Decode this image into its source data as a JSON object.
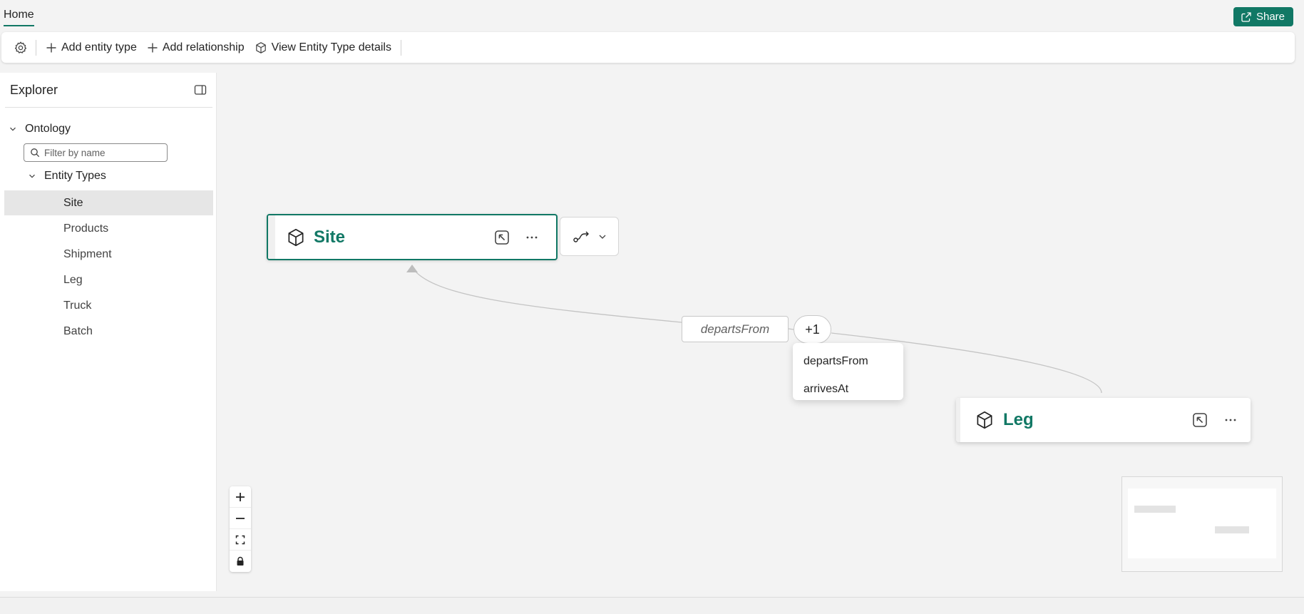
{
  "topbar": {
    "home_tab": "Home",
    "share_label": "Share"
  },
  "toolbar": {
    "settings_icon": "gear-icon",
    "add_entity_type": "Add entity type",
    "add_relationship": "Add relationship",
    "view_entity_type_details": "View Entity Type details"
  },
  "explorer": {
    "title": "Explorer",
    "root_label": "Ontology",
    "filter_placeholder": "Filter by name",
    "group_label": "Entity Types",
    "items": [
      {
        "label": "Site",
        "selected": true
      },
      {
        "label": "Products",
        "selected": false
      },
      {
        "label": "Shipment",
        "selected": false
      },
      {
        "label": "Leg",
        "selected": false
      },
      {
        "label": "Truck",
        "selected": false
      },
      {
        "label": "Batch",
        "selected": false
      }
    ]
  },
  "canvas": {
    "nodes": {
      "site": {
        "title": "Site"
      },
      "leg": {
        "title": "Leg"
      }
    },
    "edge_label": "departsFrom",
    "edge_overflow": "+1",
    "edge_menu": [
      "departsFrom",
      "arrivesAt"
    ]
  },
  "colors": {
    "accent": "#117865",
    "canvas_background": "#f3f3f3",
    "selected_row": "#e6e6e6"
  }
}
